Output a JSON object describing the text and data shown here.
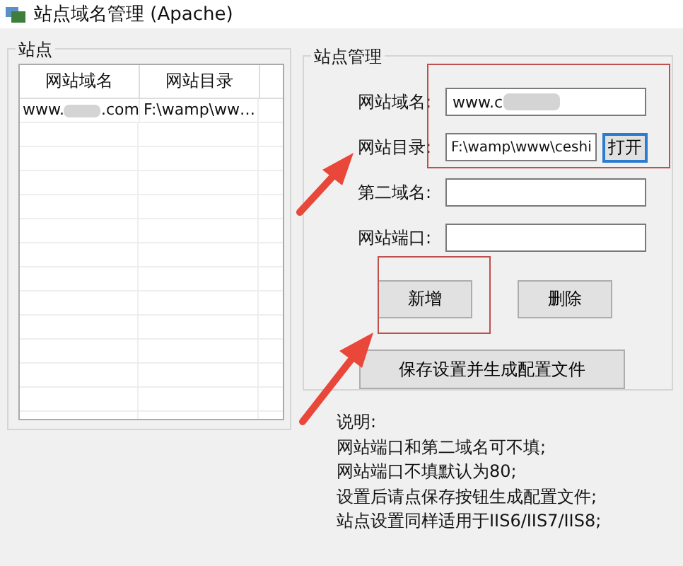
{
  "window": {
    "title": "站点域名管理 (Apache)"
  },
  "sites": {
    "title": "站点",
    "columns": [
      "网站域名",
      "网站目录"
    ],
    "rows": [
      {
        "domain": "www.",
        "domain_end": ".com",
        "dir": "F:\\wamp\\ww…",
        "selected": false
      }
    ]
  },
  "manage": {
    "title": "站点管理",
    "fields": [
      {
        "label": "网站域名:",
        "value": "www.c",
        "kind": "redacted"
      },
      {
        "label": "网站目录:",
        "value": "F:\\wamp\\www\\ceshi",
        "kind": "browse",
        "button": "打开"
      },
      {
        "label": "第二域名:",
        "kind": "text"
      },
      {
        "label": "网站端口:",
        "kind": "text"
      }
    ],
    "buttons": [
      "新增",
      "删除"
    ],
    "save_button": "保存设置并生成配置文件"
  },
  "notes": [
    "说明:",
    "网站端口和第二域名可不填;",
    "网站端口不填默认为80;",
    "设置后请点保存按钮生成配置文件;",
    "站点设置同样适用于IIS6/IIS7/IIS8;"
  ]
}
